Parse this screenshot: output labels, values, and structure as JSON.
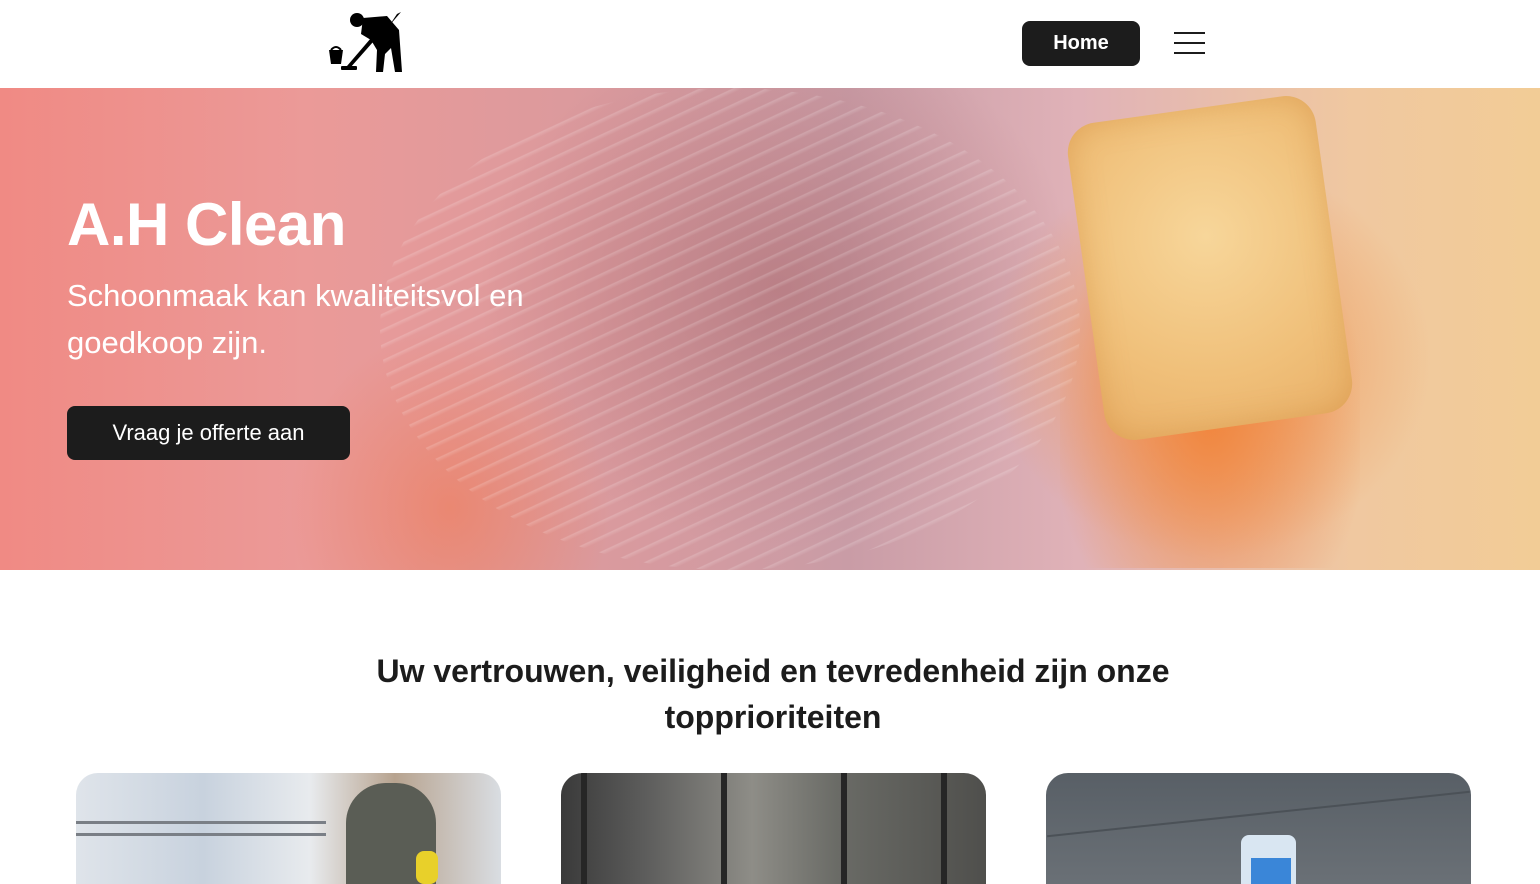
{
  "header": {
    "logo_icon": "cleaning-person-mop-bucket-icon",
    "home_label": "Home",
    "menu_icon": "hamburger-menu-icon"
  },
  "hero": {
    "title": "A.H Clean",
    "subtitle": "Schoonmaak kan kwaliteitsvol en goedkoop zijn.",
    "cta_label": "Vraag je offerte aan"
  },
  "section": {
    "title": "Uw vertrouwen, veiligheid en tevredenheid zijn onze topprioriteiten"
  },
  "colors": {
    "dark": "#1c1c1c",
    "white": "#ffffff",
    "hero_pink": "#f08a84",
    "hero_orange": "#f2cc96"
  }
}
